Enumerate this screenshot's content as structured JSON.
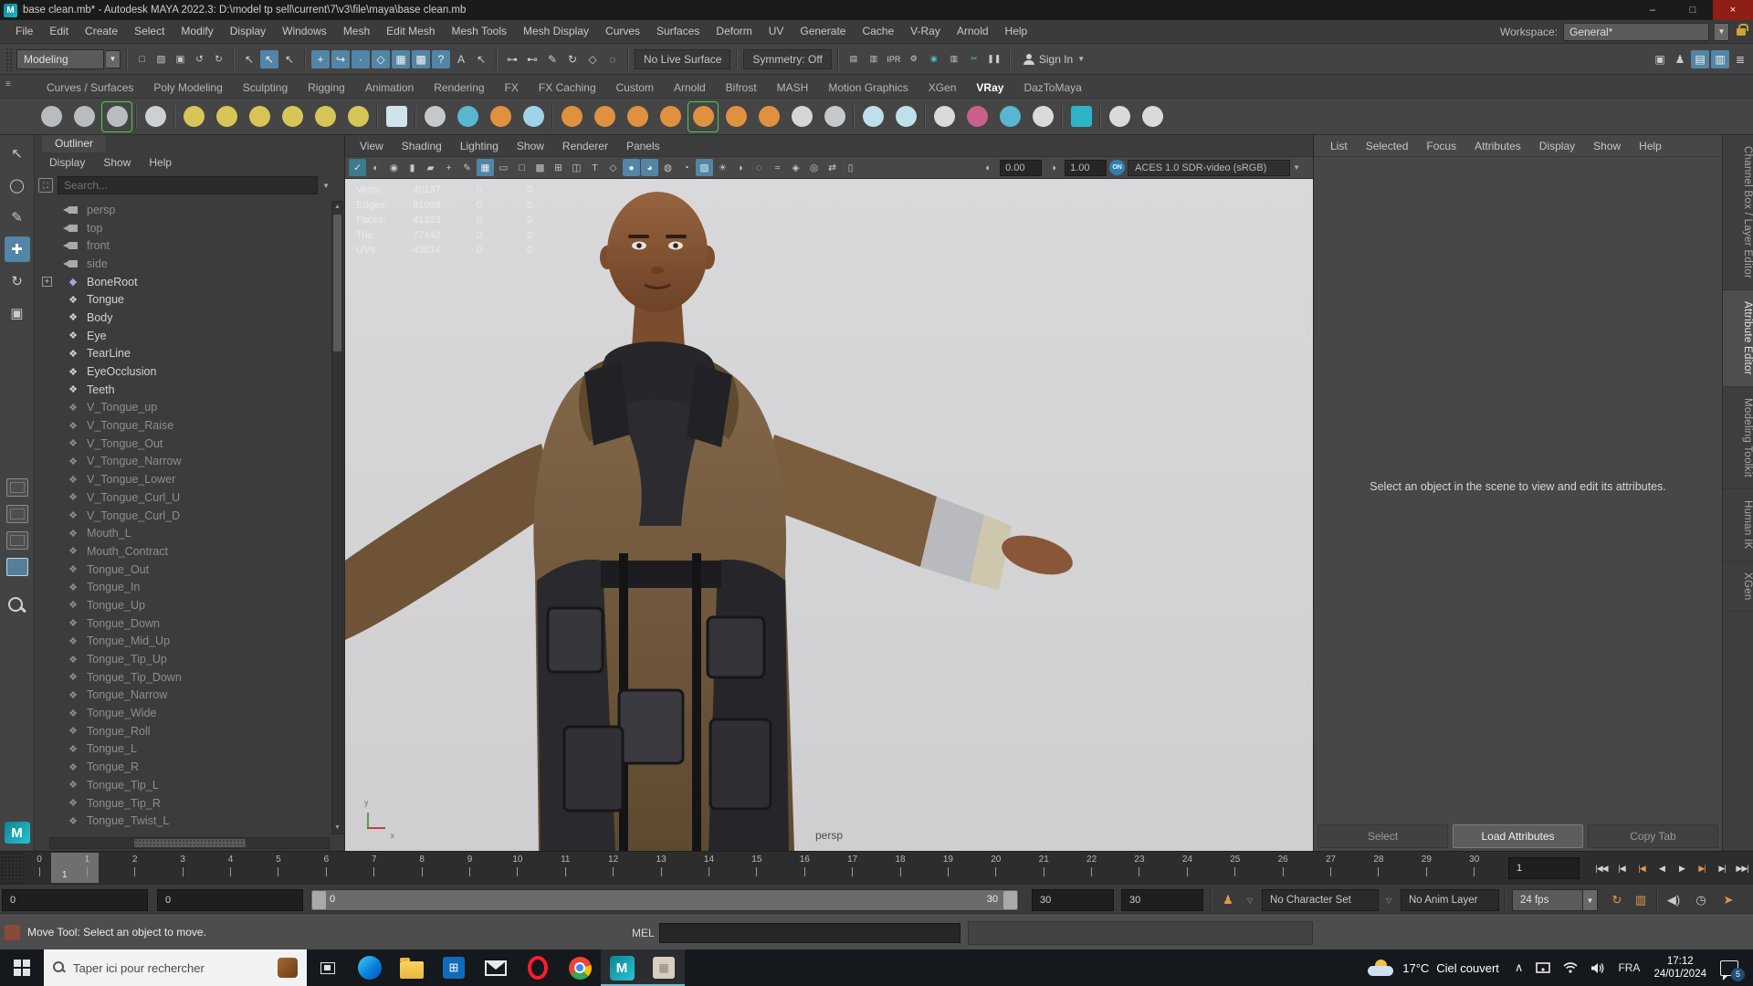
{
  "title_bar": {
    "title": "base clean.mb* - Autodesk MAYA 2022.3: D:\\model tp sell\\current\\7\\v3\\file\\maya\\base clean.mb",
    "minimize": "–",
    "maximize": "□",
    "close": "×"
  },
  "menu_bar": {
    "items": [
      "File",
      "Edit",
      "Create",
      "Select",
      "Modify",
      "Display",
      "Windows",
      "Mesh",
      "Edit Mesh",
      "Mesh Tools",
      "Mesh Display",
      "Curves",
      "Surfaces",
      "Deform",
      "UV",
      "Generate",
      "Cache",
      "V-Ray",
      "Arnold",
      "Help"
    ],
    "workspace_label": "Workspace:",
    "workspace_value": "General*"
  },
  "status_line": {
    "mode": "Modeling",
    "files": [
      {
        "n": "new-scene-icon",
        "g": "□"
      },
      {
        "n": "open-scene-icon",
        "g": "▧"
      },
      {
        "n": "save-scene-icon",
        "g": "▣"
      },
      {
        "n": "undo-icon",
        "g": "↺"
      },
      {
        "n": "redo-icon",
        "g": "↻"
      }
    ],
    "masks": [
      {
        "n": "select-by-hierarchy-icon",
        "g": "↖"
      },
      {
        "n": "select-by-object-icon",
        "g": "↖",
        "a": 1
      },
      {
        "n": "select-by-component-icon",
        "g": "↖"
      }
    ],
    "snaps": [
      {
        "n": "snap-to-grid-icon",
        "g": "+",
        "a": 1
      },
      {
        "n": "snap-to-curve-icon",
        "g": "↪",
        "a": 1
      },
      {
        "n": "snap-to-point-icon",
        "g": "∙",
        "a": 1
      },
      {
        "n": "snap-to-projected-center-icon",
        "g": "◇",
        "a": 1
      },
      {
        "n": "snap-to-view-plane-icon",
        "g": "▦",
        "a": 1
      },
      {
        "n": "make-live-icon",
        "g": "▩",
        "a": 1
      },
      {
        "n": "snap-custom-icon",
        "g": "?",
        "a": 1
      },
      {
        "n": "lock-selection-icon",
        "g": "A"
      },
      {
        "n": "highlight-selection-icon",
        "g": "↖"
      }
    ],
    "history": [
      {
        "n": "input-connections-icon",
        "g": "⊶"
      },
      {
        "n": "output-connections-icon",
        "g": "⊷"
      },
      {
        "n": "construction-history-icon",
        "g": "✎"
      },
      {
        "n": "history-toggle-icon",
        "g": "↻"
      },
      {
        "n": "live-surface-marker-icon",
        "g": "◇"
      },
      {
        "n": "connection-editor-icon",
        "g": "◌"
      }
    ],
    "no_live_surface": "No Live Surface",
    "symmetry": "Symmetry: Off",
    "render": [
      {
        "n": "render-view-icon",
        "g": "▤"
      },
      {
        "n": "render-current-frame-icon",
        "g": "▥"
      },
      {
        "n": "ipr-render-icon",
        "g": "IPR"
      },
      {
        "n": "render-settings-icon",
        "g": "⚙"
      },
      {
        "n": "render-setup-icon",
        "g": "◉",
        "t": 1
      },
      {
        "n": "light-editor-icon",
        "g": "▥"
      },
      {
        "n": "cut-render-icon",
        "g": "✂",
        "t": 1
      },
      {
        "n": "pause-viewport-icon",
        "g": "❚❚"
      }
    ],
    "sign_in": "Sign In",
    "toggles": [
      {
        "n": "modeling-toolkit-toggle-icon",
        "g": "▣"
      },
      {
        "n": "humanik-toggle-icon",
        "g": "♟"
      },
      {
        "n": "channel-box-toggle-icon",
        "g": "▤",
        "a": 1
      },
      {
        "n": "attribute-editor-toggle-icon",
        "g": "▥",
        "a": 1
      },
      {
        "n": "layer-editor-toggle-icon",
        "g": "≣"
      }
    ]
  },
  "shelf": {
    "tabs": [
      {
        "label": "Curves / Surfaces"
      },
      {
        "label": "Poly Modeling"
      },
      {
        "label": "Sculpting"
      },
      {
        "label": "Rigging"
      },
      {
        "label": "Animation"
      },
      {
        "label": "Rendering"
      },
      {
        "label": "FX"
      },
      {
        "label": "FX Caching"
      },
      {
        "label": "Custom"
      },
      {
        "label": "Arnold"
      },
      {
        "label": "Bifrost"
      },
      {
        "label": "MASH"
      },
      {
        "label": "Motion Graphics"
      },
      {
        "label": "XGen"
      },
      {
        "label": "VRay",
        "active": 1
      },
      {
        "label": "DazToMaya"
      }
    ],
    "icons": [
      {
        "n": "vray-vfb-icon",
        "c": "#b9bcbf"
      },
      {
        "n": "vray-render-icon",
        "c": "#b9bcbf"
      },
      {
        "n": "vray-rt-render-icon",
        "c": "#b9bcbf",
        "sel": 1
      },
      {
        "sep": 1
      },
      {
        "n": "vray-render-settings-icon",
        "c": "#cdd0d3"
      },
      {
        "sep": 1
      },
      {
        "n": "vray-dome-light-icon",
        "c": "#d8c557"
      },
      {
        "n": "vray-rect-light-icon",
        "c": "#d8c557"
      },
      {
        "n": "vray-sphere-light-icon",
        "c": "#d8c557"
      },
      {
        "n": "vray-mesh-light-icon",
        "c": "#d8c557"
      },
      {
        "n": "vray-ies-light-icon",
        "c": "#d8c557"
      },
      {
        "n": "vray-sun-light-icon",
        "c": "#d8c557"
      },
      {
        "sep": 1
      },
      {
        "n": "vray-sky-icon",
        "c": "#cfe3ea",
        "sq": 1
      },
      {
        "sep": 1
      },
      {
        "n": "vray-geometry-icon",
        "c": "#c6c9cc"
      },
      {
        "n": "vray-proxy-icon",
        "c": "#57b7d0"
      },
      {
        "n": "vray-mesh-export-icon",
        "c": "#e0913f"
      },
      {
        "n": "vray-volume-grid-icon",
        "c": "#9fd4e8"
      },
      {
        "sep": 1
      },
      {
        "n": "vray-fur-icon",
        "c": "#e0913f"
      },
      {
        "n": "vray-displacement-icon",
        "c": "#e0913f"
      },
      {
        "n": "vray-grass-icon",
        "c": "#e0913f"
      },
      {
        "n": "vray-clipper-icon",
        "c": "#e0913f"
      },
      {
        "n": "vray-lattice-icon",
        "c": "#e0913f",
        "sel": 1
      },
      {
        "n": "vray-instancer-icon",
        "c": "#e0913f"
      },
      {
        "n": "vray-sphere-fur-icon",
        "c": "#e0913f"
      },
      {
        "n": "vray-spline-icon",
        "c": "#d6d6d6"
      },
      {
        "n": "vray-object-settings-icon",
        "c": "#c6c9cc"
      },
      {
        "sep": 1
      },
      {
        "n": "vray-material-cone-icon",
        "c": "#bfe0ea"
      },
      {
        "n": "vray-material-layered-icon",
        "c": "#bfe0ea"
      },
      {
        "sep": 1
      },
      {
        "n": "vray-toon-icon",
        "c": "#d8dadc"
      },
      {
        "n": "vray-random-color-icon",
        "c": "#c95f8a"
      },
      {
        "n": "vray-dots-icon",
        "c": "#57b7d0"
      },
      {
        "n": "vray-palette-icon",
        "c": "#d8dadc"
      },
      {
        "sep": 1
      },
      {
        "n": "vray-uv-checker-icon",
        "c": "#2fb4c7",
        "sq": 1
      },
      {
        "sep": 1
      },
      {
        "n": "vray-plugin-icon",
        "c": "#d8dadc"
      },
      {
        "n": "vray-logo-icon",
        "c": "#d8dadc"
      }
    ]
  },
  "toolbox": {
    "tools": [
      {
        "n": "select-tool-icon",
        "g": "↖"
      },
      {
        "n": "lasso-tool-icon",
        "g": "◯"
      },
      {
        "n": "paint-select-tool-icon",
        "g": "✎"
      },
      {
        "n": "move-tool-icon",
        "g": "✚",
        "a": 1
      },
      {
        "n": "rotate-tool-icon",
        "g": "↻"
      },
      {
        "n": "scale-tool-icon",
        "g": "▣"
      }
    ],
    "layouts": [
      {
        "n": "layout-single-pane-button"
      },
      {
        "n": "layout-four-pane-button"
      },
      {
        "n": "layout-pane-plus-button"
      },
      {
        "n": "layout-persp-outliner-button",
        "a": 1
      }
    ]
  },
  "outliner": {
    "tab": "Outliner",
    "menus": [
      "Display",
      "Show",
      "Help"
    ],
    "search_placeholder": "Search...",
    "items": [
      {
        "label": "persp",
        "cam": 1,
        "dim": 1
      },
      {
        "label": "top",
        "cam": 1,
        "dim": 1
      },
      {
        "label": "front",
        "cam": 1,
        "dim": 1
      },
      {
        "label": "side",
        "cam": 1,
        "dim": 1
      },
      {
        "label": "BoneRoot",
        "joint": 1,
        "expand": 1
      },
      {
        "label": "Tongue",
        "mesh": 1
      },
      {
        "label": "Body",
        "mesh": 1
      },
      {
        "label": "Eye",
        "mesh": 1
      },
      {
        "label": "TearLine",
        "mesh": 1
      },
      {
        "label": "EyeOcclusion",
        "mesh": 1
      },
      {
        "label": "Teeth",
        "mesh": 1
      },
      {
        "label": "V_Tongue_up",
        "mesh": 1,
        "dim": 1
      },
      {
        "label": "V_Tongue_Raise",
        "mesh": 1,
        "dim": 1
      },
      {
        "label": "V_Tongue_Out",
        "mesh": 1,
        "dim": 1
      },
      {
        "label": "V_Tongue_Narrow",
        "mesh": 1,
        "dim": 1
      },
      {
        "label": "V_Tongue_Lower",
        "mesh": 1,
        "dim": 1
      },
      {
        "label": "V_Tongue_Curl_U",
        "mesh": 1,
        "dim": 1
      },
      {
        "label": "V_Tongue_Curl_D",
        "mesh": 1,
        "dim": 1
      },
      {
        "label": "Mouth_L",
        "mesh": 1,
        "dim": 1
      },
      {
        "label": "Mouth_Contract",
        "mesh": 1,
        "dim": 1
      },
      {
        "label": "Tongue_Out",
        "mesh": 1,
        "dim": 1
      },
      {
        "label": "Tongue_In",
        "mesh": 1,
        "dim": 1
      },
      {
        "label": "Tongue_Up",
        "mesh": 1,
        "dim": 1
      },
      {
        "label": "Tongue_Down",
        "mesh": 1,
        "dim": 1
      },
      {
        "label": "Tongue_Mid_Up",
        "mesh": 1,
        "dim": 1
      },
      {
        "label": "Tongue_Tip_Up",
        "mesh": 1,
        "dim": 1
      },
      {
        "label": "Tongue_Tip_Down",
        "mesh": 1,
        "dim": 1
      },
      {
        "label": "Tongue_Narrow",
        "mesh": 1,
        "dim": 1
      },
      {
        "label": "Tongue_Wide",
        "mesh": 1,
        "dim": 1
      },
      {
        "label": "Tongue_Roll",
        "mesh": 1,
        "dim": 1
      },
      {
        "label": "Tongue_L",
        "mesh": 1,
        "dim": 1
      },
      {
        "label": "Tongue_R",
        "mesh": 1,
        "dim": 1
      },
      {
        "label": "Tongue_Tip_L",
        "mesh": 1,
        "dim": 1
      },
      {
        "label": "Tongue_Tip_R",
        "mesh": 1,
        "dim": 1
      },
      {
        "label": "Tongue_Twist_L",
        "mesh": 1,
        "dim": 1
      }
    ]
  },
  "viewport": {
    "menus": [
      "View",
      "Shading",
      "Lighting",
      "Show",
      "Renderer",
      "Panels"
    ],
    "icons": [
      {
        "n": "vp-selected-camera-icon",
        "g": "✓",
        "t": 1
      },
      {
        "n": "vp-camera-lock-icon",
        "g": "◐"
      },
      {
        "n": "vp-camera-attributes-icon",
        "g": "◉"
      },
      {
        "n": "vp-image-plane-icon",
        "g": "▮"
      },
      {
        "n": "vp-bookmark-icon",
        "g": "▰"
      },
      {
        "n": "vp-2d-pan-zoom-icon",
        "g": "+"
      },
      {
        "n": "vp-grease-pencil-icon",
        "g": "✎"
      },
      {
        "n": "vp-grid-icon",
        "g": "▦",
        "a": 1
      },
      {
        "n": "vp-film-gate-icon",
        "g": "▭"
      },
      {
        "n": "vp-resolution-gate-icon",
        "g": "□"
      },
      {
        "n": "vp-gate-mask-icon",
        "g": "▩"
      },
      {
        "n": "vp-field-chart-icon",
        "g": "⊞"
      },
      {
        "n": "vp-safe-action-icon",
        "g": "◫"
      },
      {
        "n": "vp-safe-title-icon",
        "g": "T"
      },
      {
        "n": "vp-wireframe-icon",
        "g": "◇"
      },
      {
        "n": "vp-shaded-icon",
        "g": "●",
        "a": 1
      },
      {
        "n": "vp-textured-icon",
        "g": "◕",
        "a": 1
      },
      {
        "n": "vp-use-default-material-icon",
        "g": "◍"
      },
      {
        "n": "vp-wireframe-on-shaded-icon",
        "g": "◔"
      },
      {
        "n": "vp-checker-icon",
        "g": "▨",
        "a": 1
      },
      {
        "n": "vp-lights-icon",
        "g": "☀"
      },
      {
        "n": "vp-shadows-icon",
        "g": "◗"
      },
      {
        "n": "vp-occlusion-icon",
        "g": "◌"
      },
      {
        "n": "vp-motion-blur-icon",
        "g": "≈"
      },
      {
        "n": "vp-isolate-select-icon",
        "g": "◈"
      },
      {
        "n": "vp-xray-icon",
        "g": "◎"
      },
      {
        "n": "vp-swap-view-icon",
        "g": "⇄"
      },
      {
        "n": "vp-onion-skin-icon",
        "g": "▯"
      }
    ],
    "exposure_icon": "◐",
    "exposure": "0.00",
    "gamma_icon": "◑",
    "gamma": "1.00",
    "on_badge": "ON",
    "colorspace": "ACES 1.0 SDR-video (sRGB)",
    "hud_rows": [
      {
        "label": "Verts:",
        "value": "40137",
        "c1": "0",
        "c2": "0"
      },
      {
        "label": "Edges:",
        "value": "81998",
        "c1": "0",
        "c2": "0"
      },
      {
        "label": "Faces:",
        "value": "41323",
        "c1": "0",
        "c2": "0"
      },
      {
        "label": "Tris:",
        "value": "77442",
        "c1": "0",
        "c2": "0"
      },
      {
        "label": "UVs:",
        "value": "43814",
        "c1": "0",
        "c2": "0"
      }
    ],
    "camera_label": "persp",
    "axis_y": "y",
    "axis_x": "x"
  },
  "attribute_editor": {
    "menus": [
      "List",
      "Selected",
      "Focus",
      "Attributes",
      "Display",
      "Show",
      "Help"
    ],
    "message": "Select an object in the scene to view and edit its attributes.",
    "buttons": [
      {
        "label": "Select",
        "dim": 1
      },
      {
        "label": "Load Attributes",
        "primary": 1
      },
      {
        "label": "Copy Tab",
        "dim": 1
      }
    ]
  },
  "right_tabs": [
    {
      "label": "Channel Box / Layer Editor"
    },
    {
      "label": "Attribute Editor",
      "active": 1
    },
    {
      "label": "Modeling Toolkit"
    },
    {
      "label": "Human IK"
    },
    {
      "label": "XGen"
    }
  ],
  "timeline": {
    "ticks": [
      "0",
      "1",
      "2",
      "3",
      "4",
      "5",
      "6",
      "7",
      "8",
      "9",
      "10",
      "11",
      "12",
      "13",
      "14",
      "15",
      "16",
      "17",
      "18",
      "19",
      "20",
      "21",
      "22",
      "23",
      "24",
      "25",
      "26",
      "27",
      "28",
      "29",
      "30"
    ],
    "current_frame": "1",
    "current_frame_field": "1",
    "playback": [
      {
        "n": "go-to-start-button",
        "g": "|◀◀"
      },
      {
        "n": "step-back-frame-button",
        "g": "|◀"
      },
      {
        "n": "step-back-key-button",
        "g": "|◀",
        "key": 1
      },
      {
        "n": "play-backward-button",
        "g": "◀"
      },
      {
        "n": "play-forward-button",
        "g": "▶"
      },
      {
        "n": "step-forward-key-button",
        "g": "▶|",
        "key": 1
      },
      {
        "n": "step-forward-frame-button",
        "g": "▶|"
      },
      {
        "n": "go-to-end-button",
        "g": "▶▶|"
      }
    ]
  },
  "range_slider": {
    "playback_start": "0",
    "anim_start": "0",
    "range_start_label": "0",
    "range_end_label": "30",
    "anim_end": "30",
    "playback_end": "30",
    "character_set": "No Character Set",
    "anim_layer": "No Anim Layer",
    "fps": "24 fps"
  },
  "help_line": {
    "message": "Move Tool: Select an object to move.",
    "mel_label": "MEL"
  },
  "taskbar": {
    "search_placeholder": "Taper ici pour rechercher",
    "weather_temp": "17°C",
    "weather_desc": "Ciel couvert",
    "lang": "FRA",
    "time": "17:12",
    "date": "24/01/2024",
    "badge": "5",
    "store_glyph": "⊞",
    "maya_glyph": "M",
    "extra_glyph": "▦"
  }
}
